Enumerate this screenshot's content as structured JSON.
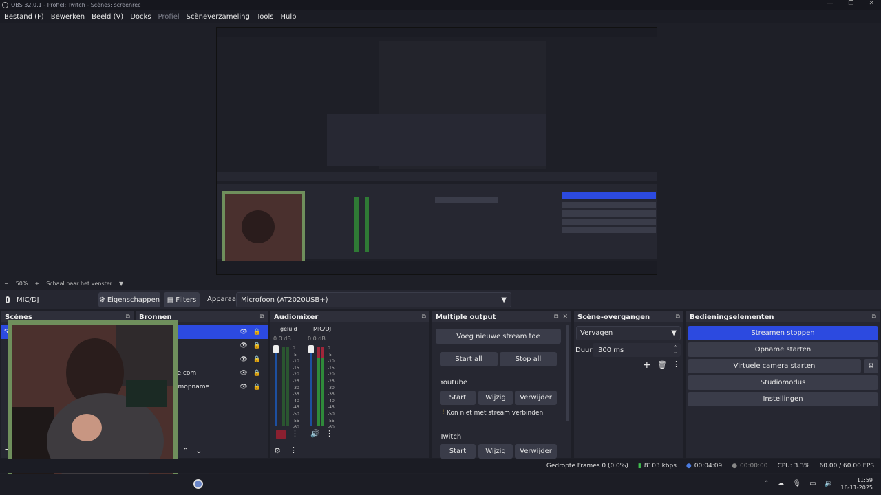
{
  "window": {
    "title": "OBS 32.0.1 - Profiel: Twitch - Scènes: screenrec",
    "minimize": "—",
    "maximize": "❐",
    "close": "✕"
  },
  "menu": [
    "Bestand (F)",
    "Bewerken",
    "Beeld (V)",
    "Docks",
    "Profiel",
    "Scèneverzameling",
    "Tools",
    "Hulp"
  ],
  "zoombar": {
    "minus": "−",
    "zoom": "50%",
    "plus": "+",
    "scale_label": "Schaal naar het venster",
    "caret": "▼"
  },
  "device": {
    "mic_label": "MIC/DJ",
    "properties": "Eigenschappen",
    "filters": "Filters",
    "device_label": "Apparaat",
    "device_value": "Microfoon (AT2020USB+)"
  },
  "scenes": {
    "title": "Scènes",
    "selected_partial": "Sc",
    "add": "+"
  },
  "sources": {
    "title": "Bronnen",
    "items": [
      "",
      "",
      "",
      "le.com",
      "rmopname"
    ],
    "up": "⌃",
    "down": "⌄"
  },
  "audiomixer": {
    "title": "Audiomixer",
    "channels": [
      {
        "name": "geluid",
        "db": "0.0 dB"
      },
      {
        "name": "MIC/DJ",
        "db": "0.0 dB"
      }
    ],
    "scale": [
      "0",
      "-5",
      "-10",
      "-15",
      "-20",
      "-25",
      "-30",
      "-35",
      "-40",
      "-45",
      "-50",
      "-55",
      "-60"
    ]
  },
  "multiple_output": {
    "title": "Multiple output",
    "add_stream": "Voeg nieuwe stream toe",
    "start_all": "Start all",
    "stop_all": "Stop all",
    "targets": [
      {
        "name": "Youtube",
        "start": "Start",
        "edit": "Wijzig",
        "remove": "Verwijder",
        "status": "Kon niet met stream verbinden.",
        "status_icon": "!"
      },
      {
        "name": "Twitch",
        "start": "Start",
        "edit": "Wijzig",
        "remove": "Verwijder"
      }
    ]
  },
  "transitions": {
    "title": "Scène-overgangen",
    "type": "Vervagen",
    "duration_label": "Duur",
    "duration_value": "300 ms"
  },
  "controls": {
    "title": "Bedieningselementen",
    "stop_stream": "Streamen stoppen",
    "start_record": "Opname starten",
    "virtual_cam": "Virtuele camera starten",
    "studio": "Studiomodus",
    "settings": "Instellingen"
  },
  "status": {
    "dropped": "Gedropte Frames 0 (0.0%)",
    "kbps": "8103 kbps",
    "stream_time": "00:04:09",
    "rec_time": "00:00:00",
    "cpu": "CPU: 3.3%",
    "fps": "60.00 / 60.00 FPS"
  },
  "taskbar": {
    "time": "11:59",
    "date": "16-11-2025"
  },
  "colors": {
    "accent": "#2c4ae0",
    "bg": "#1e1f27",
    "panel": "#262731",
    "button": "#3a3c49",
    "webcam_border": "#6f8f5c"
  }
}
